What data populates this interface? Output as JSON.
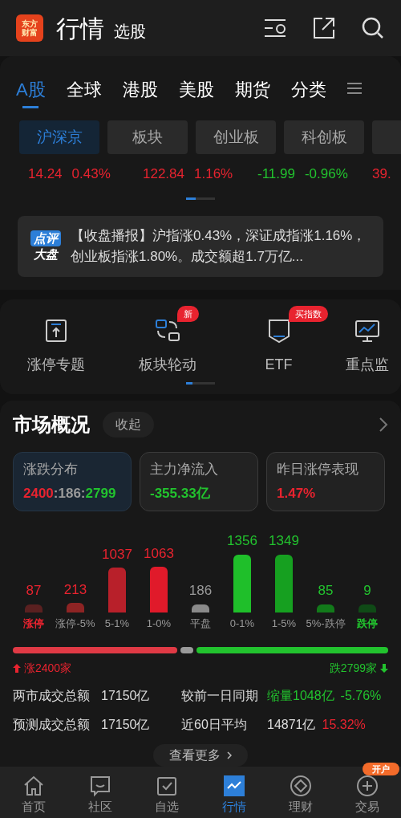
{
  "header": {
    "logo": [
      "东方",
      "财富"
    ],
    "title": "行情",
    "subtitle": "选股"
  },
  "market_tabs": [
    {
      "label": "A股",
      "selected": true
    },
    {
      "label": "全球",
      "selected": false
    },
    {
      "label": "港股",
      "selected": false
    },
    {
      "label": "美股",
      "selected": false
    },
    {
      "label": "期货",
      "selected": false
    },
    {
      "label": "分类",
      "selected": false
    }
  ],
  "sub_tabs": [
    {
      "label": "沪深京",
      "selected": true
    },
    {
      "label": "板块",
      "selected": false
    },
    {
      "label": "创业板",
      "selected": false
    },
    {
      "label": "科创板",
      "selected": false
    }
  ],
  "indices": [
    {
      "change": "14.24",
      "percent": "0.43%",
      "kind": "up"
    },
    {
      "change": "122.84",
      "percent": "1.16%",
      "kind": "up"
    },
    {
      "change": "-11.99",
      "percent": "-0.96%",
      "kind": "down"
    },
    {
      "change": "39.",
      "kind": "up"
    }
  ],
  "news": {
    "badge": [
      "点评",
      "大盘"
    ],
    "text": "【收盘播报】沪指涨0.43%，深证成指涨1.16%，创业板指涨1.80%。成交额超1.7万亿..."
  },
  "tools": [
    {
      "label": "涨停专题",
      "kind": "limit"
    },
    {
      "label": "板块轮动",
      "kind": "rotation",
      "badge": "新"
    },
    {
      "label": "ETF",
      "kind": "fund",
      "badge": "买指数"
    },
    {
      "label": "重点监",
      "kind": "monitor"
    }
  ],
  "overview": {
    "title": "市场概况",
    "collapse": "收起",
    "cards": [
      {
        "title": "涨跌分布",
        "selected": true,
        "parts": [
          {
            "text": "2400",
            "kind": "up"
          },
          {
            "text": ":186:",
            "kind": "flat"
          },
          {
            "text": "2799",
            "kind": "down"
          }
        ]
      },
      {
        "title": "主力净流入",
        "selected": false,
        "parts": [
          {
            "text": "-355.33亿",
            "kind": "down"
          }
        ]
      },
      {
        "title": "昨日涨停表现",
        "selected": false,
        "parts": [
          {
            "text": "1.47%",
            "kind": "up"
          }
        ]
      }
    ],
    "distribution": [
      {
        "label": "涨停",
        "count": "87",
        "color": "#5a2020",
        "kind": "up",
        "limit": true
      },
      {
        "label": "涨停-5%",
        "count": "213",
        "color": "#8e2424",
        "kind": "up",
        "limit": false
      },
      {
        "label": "5-1%",
        "count": "1037",
        "color": "#b8202a",
        "kind": "up",
        "limit": false
      },
      {
        "label": "1-0%",
        "count": "1063",
        "color": "#e01a2a",
        "kind": "up",
        "limit": false
      },
      {
        "label": "平盘",
        "count": "186",
        "color": "#8a8a8a",
        "kind": "flat",
        "limit": false
      },
      {
        "label": "0-1%",
        "count": "1356",
        "color": "#1fbf2a",
        "kind": "down",
        "limit": false
      },
      {
        "label": "1-5%",
        "count": "1349",
        "color": "#16a020",
        "kind": "down",
        "limit": false
      },
      {
        "label": "5%-跌停",
        "count": "85",
        "color": "#127a1a",
        "kind": "down",
        "limit": false
      },
      {
        "label": "跌停",
        "count": "9",
        "color": "#0f4a16",
        "kind": "down",
        "limit": true
      }
    ],
    "up_total": "涨2400家",
    "down_total": "跌2799家",
    "stats": [
      {
        "label": "两市成交总额",
        "value": "17150亿",
        "compare_label": "较前一日同期",
        "compare_parts": [
          {
            "text": "缩量1048亿",
            "kind": "down"
          },
          {
            "text": "-5.76%",
            "kind": "down"
          }
        ]
      },
      {
        "label": "预测成交总额",
        "value": "17150亿",
        "compare_label": "近60日平均",
        "compare_parts": [
          {
            "text": "14871亿",
            "kind": "flat"
          },
          {
            "text": "15.32%",
            "kind": "up"
          }
        ]
      }
    ],
    "more": "查看更多"
  },
  "nav": [
    {
      "label": "首页",
      "kind": "home",
      "selected": false
    },
    {
      "label": "社区",
      "kind": "chat",
      "selected": false
    },
    {
      "label": "自选",
      "kind": "check",
      "selected": false
    },
    {
      "label": "行情",
      "kind": "chart",
      "selected": true
    },
    {
      "label": "理财",
      "kind": "diamond",
      "selected": false
    },
    {
      "label": "交易",
      "kind": "plus",
      "selected": false,
      "badge": "开户"
    }
  ]
}
